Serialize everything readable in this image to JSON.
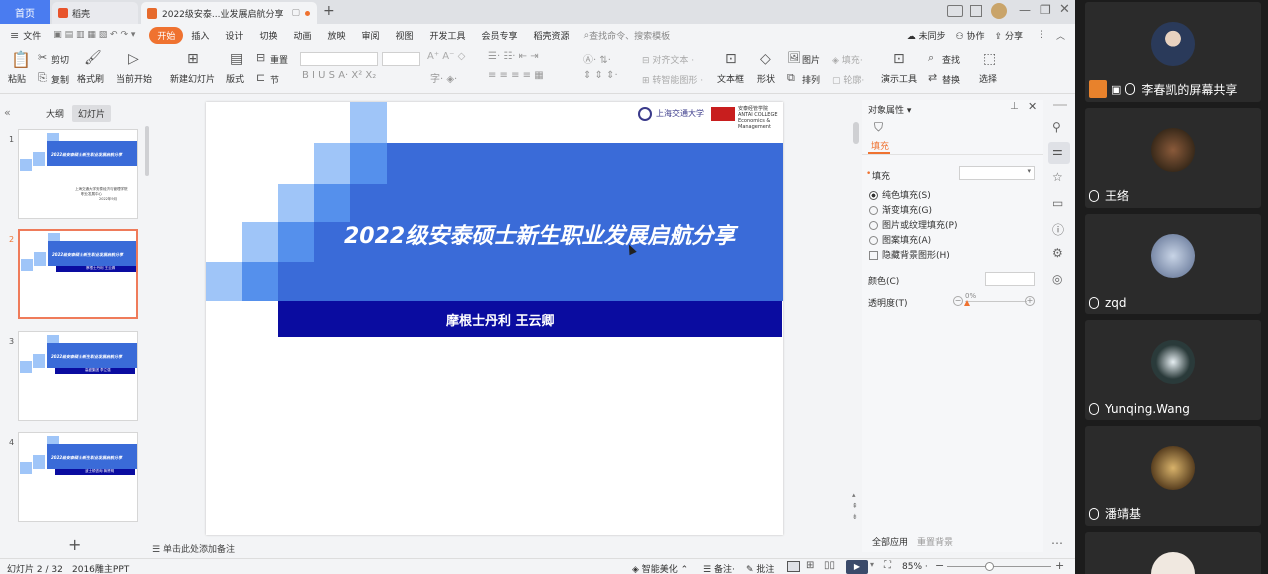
{
  "tabs": {
    "home": "首页",
    "daoke": "稻壳",
    "doc": "2022级安泰...业发展启航分享"
  },
  "menu": {
    "file": "文件",
    "items": [
      "开始",
      "插入",
      "设计",
      "切换",
      "动画",
      "放映",
      "审阅",
      "视图",
      "开发工具",
      "会员专享",
      "稻壳资源"
    ],
    "search_placeholder": "查找命令、搜索模板",
    "sync": "未同步",
    "collab": "协作",
    "share": "分享"
  },
  "ribbon": {
    "paste": "粘贴",
    "cut": "剪切",
    "copy": "复制",
    "format_painter": "格式刷",
    "start_from": "当前开始",
    "new_slide": "新建幻灯片",
    "layout": "版式",
    "reset": "重置",
    "section": "节",
    "align_text": "对齐文本",
    "convert_smartart": "转智能图形",
    "textbox": "文本框",
    "shape": "形状",
    "picture": "图片",
    "fill": "填充",
    "arrange": "排列",
    "outline": "轮廓",
    "presenter_tools": "演示工具",
    "find": "查找",
    "replace": "替换",
    "select": "选择"
  },
  "left_panel": {
    "outline_tab": "大纲",
    "slides_tab": "幻灯片",
    "slide_numbers": [
      "1",
      "2",
      "3",
      "4"
    ]
  },
  "slide": {
    "title": "2022级安泰硕士新生职业发展启航分享",
    "subtitle": "摩根士丹利 王云卿",
    "logo_sjtu": "上海交通大学",
    "logo_antai_cn": "安泰经管学院",
    "logo_antai_en1": "ANTAI COLLEGE",
    "logo_antai_en2": "Economics & Management",
    "colors": {
      "main_blue": "#3a6bd8",
      "dark_blue": "#0a0ca0",
      "light_blue": "#9fc5f8",
      "mid_blue": "#5590ec"
    }
  },
  "thumbs": [
    {
      "title": "2022级安泰硕士新生职业发展启航分享",
      "lines": [
        "上海交通大学安泰经济与管理学院",
        "职业发展中心",
        "2022年9月"
      ]
    },
    {
      "title": "2022级安泰硕士新生职业发展启航分享",
      "sub": "摩根士丹利 王云卿"
    },
    {
      "title": "2022级安泰硕士新生职业发展启航分享",
      "sub": "高盛集团 李立强"
    },
    {
      "title": "2022级安泰硕士新生职业发展启航分享",
      "sub": "波士顿咨询 蒋赞明"
    }
  ],
  "properties": {
    "header": "对象属性",
    "fill_tab": "填充",
    "fill_section": "填充",
    "options": [
      "纯色填充(S)",
      "渐变填充(G)",
      "图片或纹理填充(P)",
      "图案填充(A)"
    ],
    "hide_bg": "隐藏背景图形(H)",
    "color_label": "颜色(C)",
    "transparency_label": "透明度(T)",
    "transparency_value": "0%",
    "apply_all": "全部应用",
    "reset_bg": "重置背景"
  },
  "notes": "单击此处添加备注",
  "status": {
    "slide_counter": "幻灯片 2 / 32",
    "theme": "2016雕主PPT",
    "beautify": "智能美化",
    "notes_btn": "备注",
    "comment_btn": "批注",
    "zoom": "85%"
  },
  "participants": [
    {
      "name": "李春凯的屏幕共享"
    },
    {
      "name": "王络"
    },
    {
      "name": "zqd"
    },
    {
      "name": "Yunqing.Wang"
    },
    {
      "name": "潘靖基"
    }
  ]
}
